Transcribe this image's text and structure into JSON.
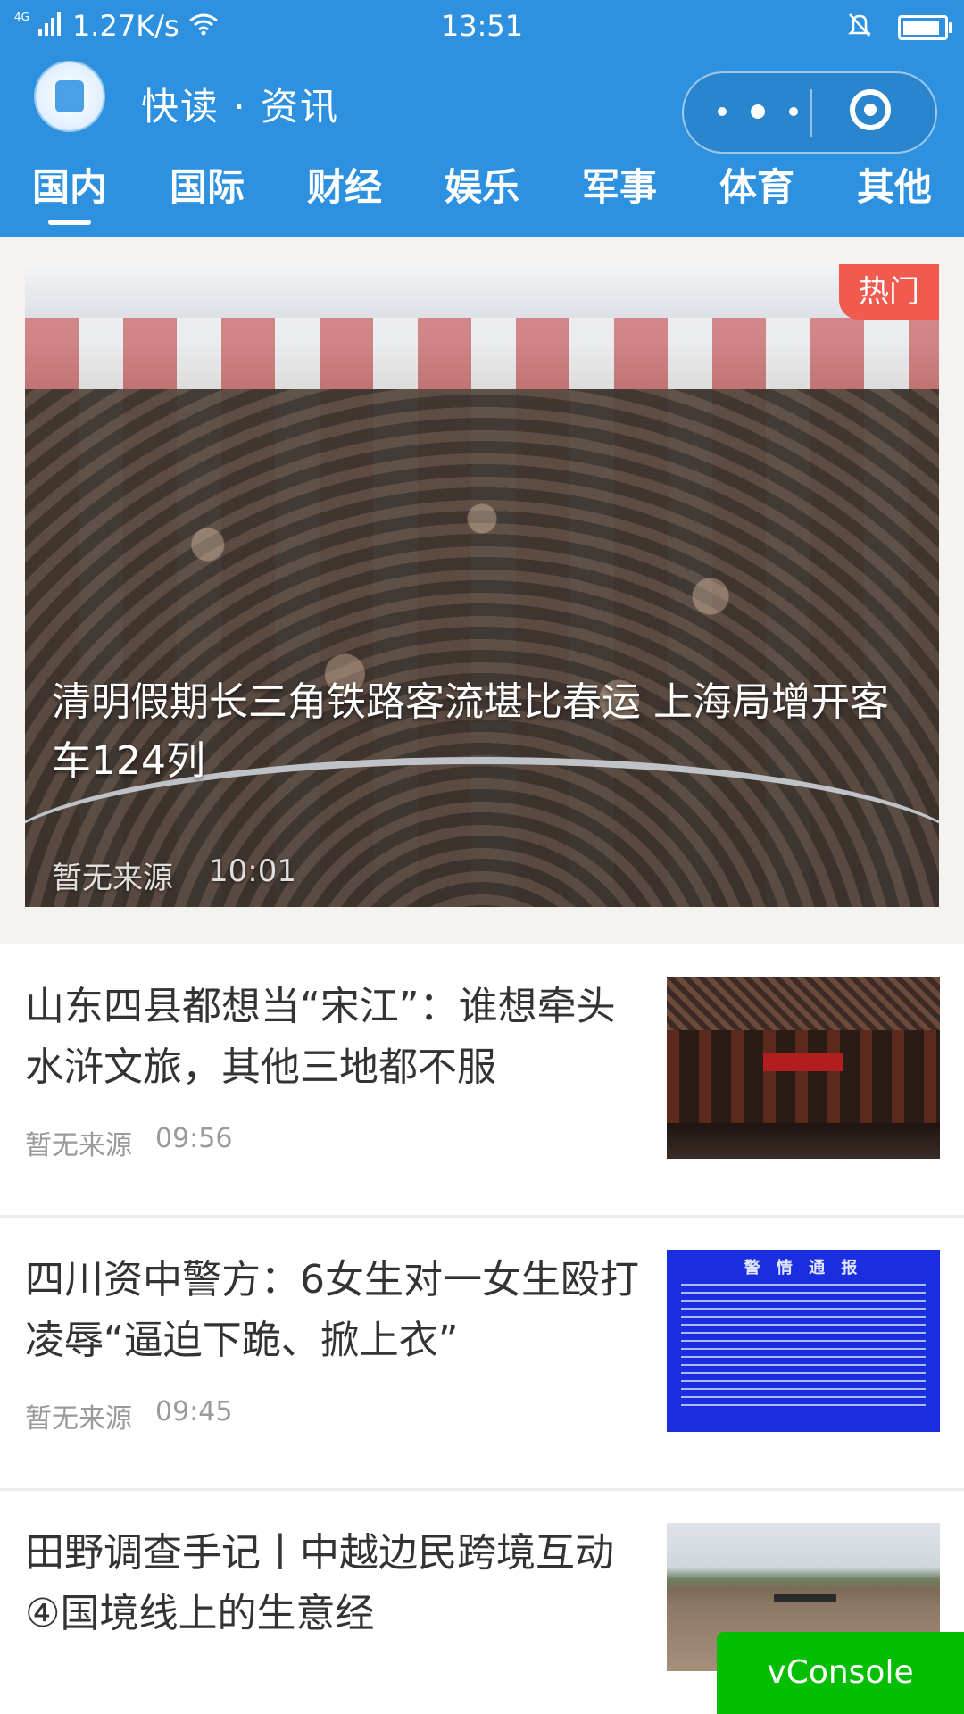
{
  "status_bar": {
    "network": "4G",
    "speed": "1.27K/s",
    "time": "13:51",
    "icons": [
      "signal-icon",
      "wifi-icon",
      "mute-icon",
      "battery-icon"
    ]
  },
  "header": {
    "app_title": "快读 · 资讯",
    "menu_icon": "more-dots-icon",
    "close_icon": "target-icon",
    "background_color": "#2d91e0"
  },
  "tabs": [
    {
      "label": "国内",
      "active": true
    },
    {
      "label": "国际",
      "active": false
    },
    {
      "label": "财经",
      "active": false
    },
    {
      "label": "娱乐",
      "active": false
    },
    {
      "label": "军事",
      "active": false
    },
    {
      "label": "体育",
      "active": false
    },
    {
      "label": "其他",
      "active": false
    }
  ],
  "hero": {
    "badge": "热门",
    "title": "清明假期长三角铁路客流堪比春运 上海局增开客车124列",
    "source": "暂无来源",
    "time": "10:01",
    "badge_color": "#f05a4f"
  },
  "news": [
    {
      "title": "山东四县都想当“宋江”：谁想牵头水浒文旅，其他三地都不服",
      "source": "暂无来源",
      "time": "09:56"
    },
    {
      "title": "四川资中警方：6女生对一女生殴打凌辱“逼迫下跪、掀上衣”",
      "source": "暂无来源",
      "time": "09:45",
      "thumb_heading": "警 情 通 报"
    },
    {
      "title": "田野调查手记丨中越边民跨境互动④国境线上的生意经",
      "source": "",
      "time": ""
    }
  ],
  "vconsole": {
    "label": "vConsole",
    "color": "#04be02"
  }
}
